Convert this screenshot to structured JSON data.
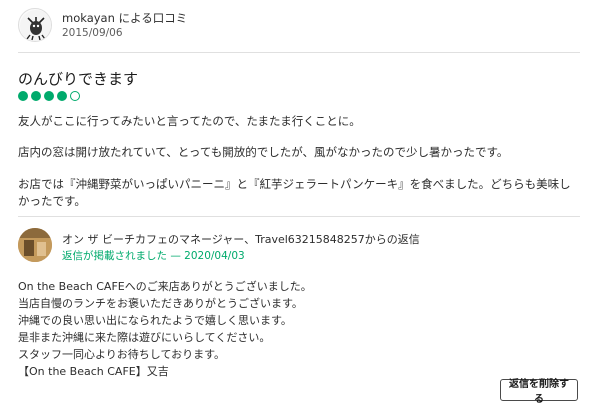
{
  "review": {
    "reviewer_line": "mokayan による口コミ",
    "date": "2015/09/06",
    "title": "のんびりできます",
    "rating": 4,
    "rating_max": 5,
    "paragraphs": [
      "友人がここに行ってみたいと言ってたので、たまたま行くことに。",
      "店内の窓は開け放たれていて、とっても開放的でしたが、風がなかったので少し暑かったです。",
      "お店では『沖縄野菜がいっぱいパニーニ』と『紅芋ジェラートパンケーキ』を食べました。どちらも美味しかったです。"
    ]
  },
  "owner_response": {
    "header": "オン ザ ビーチカフェのマネージャー、Travel63215848257からの返信",
    "posted_text": "返信が掲載されました — 2020/04/03",
    "lines": [
      "On the Beach CAFEへのご来店ありがとうございました。",
      "当店自慢のランチをお褒いただきありがとうございます。",
      "沖縄での良い思い出になられたようで嬉しく思います。",
      "是非また沖縄に来た際は遊びにいらしてください。",
      "スタッフ一同心よりお待ちしております。",
      "【On the Beach CAFE】又吉"
    ],
    "delete_button": "返信を削除する"
  },
  "colors": {
    "accent": "#00aa6c",
    "text": "#2d2d2d",
    "divider": "#e0e0e0"
  }
}
